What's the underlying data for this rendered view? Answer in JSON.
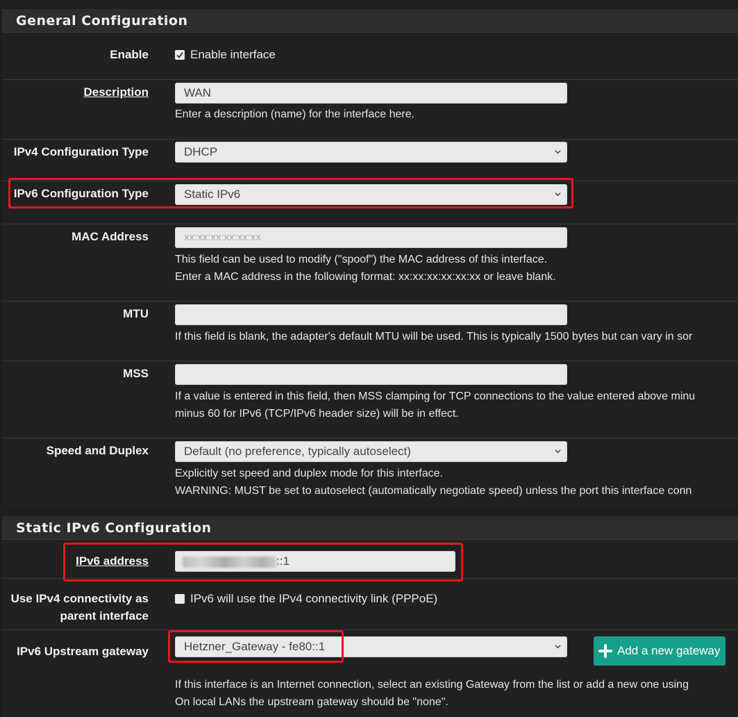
{
  "general": {
    "header": "General Configuration",
    "enable": {
      "label": "Enable",
      "checkbox_label": "Enable interface",
      "checked": true
    },
    "description": {
      "label": "Description",
      "value": "WAN",
      "help": "Enter a description (name) for the interface here."
    },
    "ipv4_type": {
      "label": "IPv4 Configuration Type",
      "value": "DHCP"
    },
    "ipv6_type": {
      "label": "IPv6 Configuration Type",
      "value": "Static IPv6"
    },
    "mac": {
      "label": "MAC Address",
      "placeholder": "xx:xx:xx:xx:xx:xx",
      "help1": "This field can be used to modify (\"spoof\") the MAC address of this interface.",
      "help2": "Enter a MAC address in the following format: xx:xx:xx:xx:xx:xx or leave blank."
    },
    "mtu": {
      "label": "MTU",
      "value": "",
      "help": "If this field is blank, the adapter's default MTU will be used. This is typically 1500 bytes but can vary in sor"
    },
    "mss": {
      "label": "MSS",
      "value": "",
      "help1": "If a value is entered in this field, then MSS clamping for TCP connections to the value entered above minu",
      "help2": "minus 60 for IPv6 (TCP/IPv6 header size) will be in effect."
    },
    "speed": {
      "label": "Speed and Duplex",
      "value": "Default (no preference, typically autoselect)",
      "help1": "Explicitly set speed and duplex mode for this interface.",
      "help2": "WARNING: MUST be set to autoselect (automatically negotiate speed) unless the port this interface conn"
    }
  },
  "static_ipv6": {
    "header": "Static IPv6 Configuration",
    "address": {
      "label": "IPv6 address",
      "value_suffix": "::1"
    },
    "parent": {
      "label_line1": "Use IPv4 connectivity as",
      "label_line2": "parent interface",
      "checkbox_label": "IPv6 will use the IPv4 connectivity link (PPPoE)",
      "checked": false
    },
    "gateway": {
      "label": "IPv6 Upstream gateway",
      "value": "Hetzner_Gateway - fe80::1",
      "add_button": "Add a new gateway",
      "help1": "If this interface is an Internet connection, select an existing Gateway from the list or add a new one using",
      "help2": "On local LANs the upstream gateway should be \"none\"."
    }
  },
  "colors": {
    "highlight": "#e8161b",
    "button": "#17a08b"
  }
}
